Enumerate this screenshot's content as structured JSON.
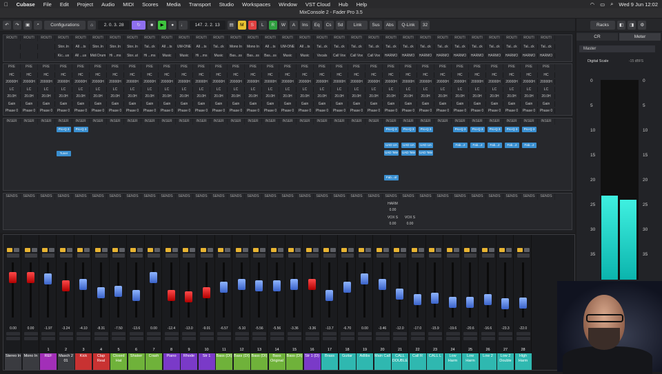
{
  "menubar": {
    "app": "Cubase",
    "items": [
      "File",
      "Edit",
      "Project",
      "Audio",
      "MIDI",
      "Scores",
      "Media",
      "Transport",
      "Studio",
      "Workspaces",
      "Window",
      "VST Cloud",
      "Hub",
      "Help"
    ],
    "clock": "Wed 9 Jun  12:02"
  },
  "window": {
    "title": "MixConsole 2 - Fader Pro 3.5"
  },
  "toolbar": {
    "configurations": "Configurations",
    "position": "2. 0. 3. 28",
    "tempo": "147. 2. 2. 13",
    "link": "Link",
    "sus": "Sus",
    "abs": "Abs",
    "qlink": "Q-Link",
    "channels": "32",
    "racks": "Racks",
    "m": "M",
    "s": "S",
    "l": "L",
    "r": "R",
    "w": "W",
    "a": "A",
    "ins": "Ins",
    "eq": "Eq",
    "cs": "Cs",
    "sd": "Sd"
  },
  "right_panel": {
    "tab_cr": "CR",
    "tab_meter": "Meter",
    "master": "Master",
    "digital_scale": "Digital Scale",
    "dbfs": "-15 dBFS",
    "scale": [
      "0",
      "5",
      "10",
      "15",
      "20",
      "25",
      "30",
      "35"
    ],
    "meter_left": 0.42,
    "meter_right": 0.4
  },
  "routing": {
    "header": "ROUTI",
    "inputs": [
      "",
      "",
      "",
      "Stor..In",
      "All ...ts",
      "Stor..In",
      "Stor..In",
      "Stor..In",
      "Tal...ck",
      "All ...ts",
      "UM-ONE",
      "All ...ts",
      "Tal...ck",
      "Mono In",
      "Mono In",
      "All ...ts",
      "UM-ONE",
      "All ...ts",
      "Tal...ck",
      "Tal...ck",
      "Tal...ck",
      "Tal...ck",
      "Tal...ck",
      "Tal...ck",
      "Tal...ck",
      "Tal...ck",
      "Tal...ck",
      "Tal...ck",
      "Tal...ck",
      "Tal...ck",
      "Tal...ck",
      "Tal...ck"
    ],
    "outputs": [
      "",
      "",
      "",
      "Kic...us",
      "All ...us",
      "Midi Drum",
      "Hi ...ms",
      "Stor..ut",
      "Hi ...ms",
      "Music",
      "Music",
      "Hi ...ms",
      "Music",
      "Bas...ss",
      "Bas...ss",
      "Bas...ss",
      "Music",
      "Music",
      "Vocals",
      "Call Vox",
      "Call Vox",
      "Call Vox",
      "HARMO",
      "HARMO",
      "HARMO",
      "HARMO",
      "HARMO",
      "HARMO",
      "HARMO",
      "HARMO",
      "HARMO",
      "HARMO"
    ]
  },
  "pre": {
    "label": "PRE",
    "hc": "HC",
    "lc": "LC",
    "hc_val": "20000H",
    "lc_val": "20.0H",
    "gain": "Gain",
    "phase": "Phase 0"
  },
  "inserts": {
    "label": "INSER",
    "proq": "Pro-Q 3",
    "tuner": "Tuner",
    "uad": "UAD UA",
    "uad2": "UAD Tele",
    "fab": "Fab...2",
    "fab2": "Fab...ol"
  },
  "sends": {
    "label": "SENDS",
    "harm": "HARM",
    "vox": "VOX S",
    "val": "0.00"
  },
  "channels": [
    {
      "num": "",
      "name": "Stereo In",
      "val": "0.00",
      "color": "#3a3b40",
      "cap": "red",
      "pos": 0.28
    },
    {
      "num": "",
      "name": "Mono In",
      "val": "0.00",
      "color": "#3a3b40",
      "cap": "red",
      "pos": 0.28
    },
    {
      "num": "1",
      "name": "REF",
      "val": "-1.97",
      "color": "#a22fb8",
      "cap": "blue",
      "pos": 0.3
    },
    {
      "num": "2",
      "name": "Masch 2 01",
      "val": "-3.24",
      "color": "#3a3b40",
      "cap": "red",
      "pos": 0.42
    },
    {
      "num": "3",
      "name": "Kick",
      "val": "-4.10",
      "color": "#c83232",
      "cap": "blue",
      "pos": 0.4
    },
    {
      "num": "4",
      "name": "Clap Real",
      "val": "-8.31",
      "color": "#c83232",
      "cap": "blue",
      "pos": 0.55
    },
    {
      "num": "5",
      "name": "Closed Hat",
      "val": "-7.50",
      "color": "#6fb23a",
      "cap": "blue",
      "pos": 0.52
    },
    {
      "num": "6",
      "name": "Shaker",
      "val": "-13.6",
      "color": "#6fb23a",
      "cap": "blue",
      "pos": 0.6
    },
    {
      "num": "7",
      "name": "Crash",
      "val": "0.00",
      "color": "#6fb23a",
      "cap": "blue",
      "pos": 0.28
    },
    {
      "num": "8",
      "name": "Piano",
      "val": "-12.4",
      "color": "#7a3ac8",
      "cap": "red",
      "pos": 0.6
    },
    {
      "num": "9",
      "name": "Rhode",
      "val": "-13.0",
      "color": "#7a3ac8",
      "cap": "red",
      "pos": 0.62
    },
    {
      "num": "10",
      "name": "Str 1",
      "val": "-9.01",
      "color": "#7a3ac8",
      "cap": "red",
      "pos": 0.55
    },
    {
      "num": "11",
      "name": "Bass (DI)",
      "val": "-6.57",
      "color": "#6fb23a",
      "cap": "blue",
      "pos": 0.45
    },
    {
      "num": "12",
      "name": "Bass (DI)",
      "val": "-5.10",
      "color": "#6fb23a",
      "cap": "blue",
      "pos": 0.4
    },
    {
      "num": "13",
      "name": "Bass (DI)",
      "val": "-5.56",
      "color": "#6fb23a",
      "cap": "blue",
      "pos": 0.43
    },
    {
      "num": "14",
      "name": "Bass Original",
      "val": "-5.56",
      "color": "#6fb23a",
      "cap": "blue",
      "pos": 0.43
    },
    {
      "num": "15",
      "name": "Bass (DI)",
      "val": "-3.36",
      "color": "#6fb23a",
      "cap": "blue",
      "pos": 0.4
    },
    {
      "num": "16",
      "name": "Str 1 (D)",
      "val": "-3.36",
      "color": "#7a3ac8",
      "cap": "red",
      "pos": 0.4
    },
    {
      "num": "17",
      "name": "Brass",
      "val": "-13.7",
      "color": "#2fb8b0",
      "cap": "blue",
      "pos": 0.6
    },
    {
      "num": "18",
      "name": "Guitar",
      "val": "-6.70",
      "color": "#2fb8b0",
      "cap": "blue",
      "pos": 0.45
    },
    {
      "num": "19",
      "name": "Adlibs",
      "val": "0.00",
      "color": "#2fb8b0",
      "cap": "blue",
      "pos": 0.3
    },
    {
      "num": "20",
      "name": "Main Call",
      "val": "-3.46",
      "color": "#2fb8b0",
      "cap": "blue",
      "pos": 0.4
    },
    {
      "num": "21",
      "name": "CALL DOUBLE",
      "val": "-12.0",
      "color": "#2fb8b0",
      "cap": "blue",
      "pos": 0.58
    },
    {
      "num": "22",
      "name": "Call R",
      "val": "-17.0",
      "color": "#2fb8b0",
      "cap": "blue",
      "pos": 0.68
    },
    {
      "num": "23",
      "name": "CALL L",
      "val": "-15.9",
      "color": "#2fb8b0",
      "cap": "blue",
      "pos": 0.65
    },
    {
      "num": "24",
      "name": "Low Harm",
      "val": "-19.6",
      "color": "#2fb8b0",
      "cap": "blue",
      "pos": 0.72
    },
    {
      "num": "25",
      "name": "Low Harm",
      "val": "-20.6",
      "color": "#2fb8b0",
      "cap": "blue",
      "pos": 0.72
    },
    {
      "num": "26",
      "name": "Low 2",
      "val": "-16.6",
      "color": "#2fb8b0",
      "cap": "blue",
      "pos": 0.68
    },
    {
      "num": "27",
      "name": "Low 2 Double",
      "val": "-23.3",
      "color": "#2fb8b0",
      "cap": "blue",
      "pos": 0.75
    },
    {
      "num": "28",
      "name": "High Harm",
      "val": "-22.0",
      "color": "#2fb8b0",
      "cap": "blue",
      "pos": 0.74
    }
  ]
}
